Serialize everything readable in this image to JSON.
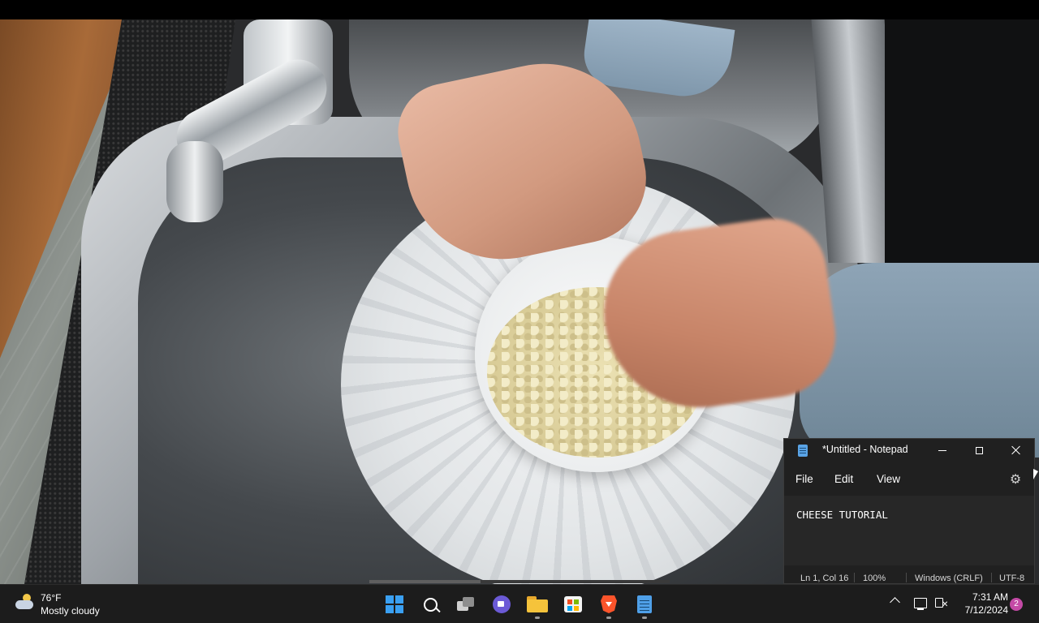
{
  "notepad": {
    "title": "*Untitled - Notepad",
    "menu": {
      "file": "File",
      "edit": "Edit",
      "view": "View"
    },
    "content": "CHEESE TUTORIAL",
    "status": {
      "position": "Ln 1, Col 16",
      "zoom": "100%",
      "line_ending": "Windows (CRLF)",
      "encoding": "UTF-8"
    },
    "icons": {
      "app": "notepad-icon",
      "settings": "gear-icon",
      "minimize": "minimize-icon",
      "maximize": "maximize-icon",
      "close": "close-icon"
    }
  },
  "video": {
    "progress_fraction": 0.37
  },
  "taskbar": {
    "weather": {
      "temperature": "76°F",
      "condition": "Mostly cloudy",
      "icon": "partly-cloudy-icon"
    },
    "apps": [
      {
        "name": "start",
        "icon": "windows-start-icon"
      },
      {
        "name": "search",
        "icon": "search-icon"
      },
      {
        "name": "task-view",
        "icon": "task-view-icon"
      },
      {
        "name": "meet",
        "icon": "meet-icon"
      },
      {
        "name": "file-explorer",
        "icon": "folder-icon",
        "running": true
      },
      {
        "name": "store",
        "icon": "store-icon"
      },
      {
        "name": "brave",
        "icon": "brave-browser-icon",
        "running": true
      },
      {
        "name": "notepad",
        "icon": "notepad-icon",
        "running": true
      }
    ],
    "tray": {
      "time": "7:31 AM",
      "date": "7/12/2024",
      "notification_count": "2"
    }
  },
  "colors": {
    "taskbar_bg": "#1c1c1c",
    "notepad_bg": "#202020",
    "accent_blue": "#3aa0f2",
    "notification_badge": "#c44aa6"
  }
}
